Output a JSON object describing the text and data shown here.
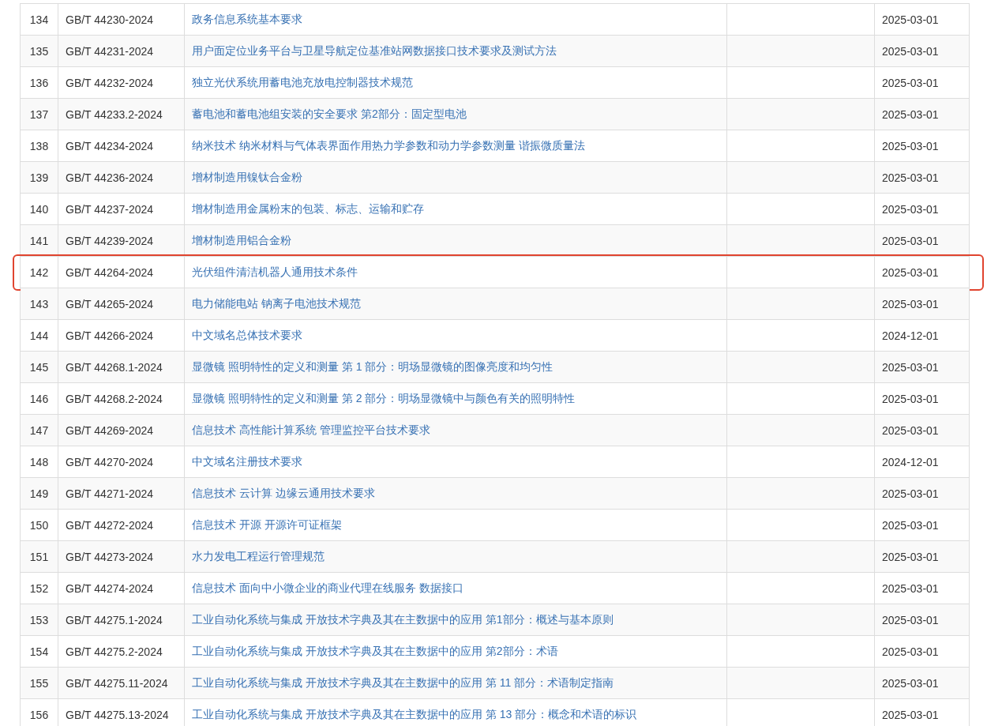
{
  "table": {
    "rows": [
      {
        "number": "134",
        "code": "GB/T 44230-2024",
        "title": "政务信息系统基本要求",
        "date": "2025-03-01",
        "highlighted": false
      },
      {
        "number": "135",
        "code": "GB/T 44231-2024",
        "title": "用户面定位业务平台与卫星导航定位基准站网数据接口技术要求及测试方法",
        "date": "2025-03-01",
        "highlighted": false
      },
      {
        "number": "136",
        "code": "GB/T 44232-2024",
        "title": "独立光伏系统用蓄电池充放电控制器技术规范",
        "date": "2025-03-01",
        "highlighted": false
      },
      {
        "number": "137",
        "code": "GB/T 44233.2-2024",
        "title": "蓄电池和蓄电池组安装的安全要求 第2部分：固定型电池",
        "date": "2025-03-01",
        "highlighted": false
      },
      {
        "number": "138",
        "code": "GB/T 44234-2024",
        "title": "纳米技术 纳米材料与气体表界面作用热力学参数和动力学参数测量 谐振微质量法",
        "date": "2025-03-01",
        "highlighted": false
      },
      {
        "number": "139",
        "code": "GB/T 44236-2024",
        "title": "增材制造用镍钛合金粉",
        "date": "2025-03-01",
        "highlighted": false
      },
      {
        "number": "140",
        "code": "GB/T 44237-2024",
        "title": "增材制造用金属粉末的包装、标志、运输和贮存",
        "date": "2025-03-01",
        "highlighted": false
      },
      {
        "number": "141",
        "code": "GB/T 44239-2024",
        "title": "增材制造用铝合金粉",
        "date": "2025-03-01",
        "highlighted": false
      },
      {
        "number": "142",
        "code": "GB/T 44264-2024",
        "title": "光伏组件清洁机器人通用技术条件",
        "date": "2025-03-01",
        "highlighted": true
      },
      {
        "number": "143",
        "code": "GB/T 44265-2024",
        "title": "电力储能电站 钠离子电池技术规范",
        "date": "2025-03-01",
        "highlighted": false
      },
      {
        "number": "144",
        "code": "GB/T 44266-2024",
        "title": "中文域名总体技术要求",
        "date": "2024-12-01",
        "highlighted": false
      },
      {
        "number": "145",
        "code": "GB/T 44268.1-2024",
        "title": "显微镜 照明特性的定义和测量 第 1 部分：明场显微镜的图像亮度和均匀性",
        "date": "2025-03-01",
        "highlighted": false
      },
      {
        "number": "146",
        "code": "GB/T 44268.2-2024",
        "title": "显微镜 照明特性的定义和测量 第 2 部分：明场显微镜中与颜色有关的照明特性",
        "date": "2025-03-01",
        "highlighted": false
      },
      {
        "number": "147",
        "code": "GB/T 44269-2024",
        "title": "信息技术 高性能计算系统 管理监控平台技术要求",
        "date": "2025-03-01",
        "highlighted": false
      },
      {
        "number": "148",
        "code": "GB/T 44270-2024",
        "title": "中文域名注册技术要求",
        "date": "2024-12-01",
        "highlighted": false
      },
      {
        "number": "149",
        "code": "GB/T 44271-2024",
        "title": "信息技术 云计算 边缘云通用技术要求",
        "date": "2025-03-01",
        "highlighted": false
      },
      {
        "number": "150",
        "code": "GB/T 44272-2024",
        "title": "信息技术 开源 开源许可证框架",
        "date": "2025-03-01",
        "highlighted": false
      },
      {
        "number": "151",
        "code": "GB/T 44273-2024",
        "title": "水力发电工程运行管理规范",
        "date": "2025-03-01",
        "highlighted": false
      },
      {
        "number": "152",
        "code": "GB/T 44274-2024",
        "title": "信息技术 面向中小微企业的商业代理在线服务 数据接口",
        "date": "2025-03-01",
        "highlighted": false
      },
      {
        "number": "153",
        "code": "GB/T 44275.1-2024",
        "title": "工业自动化系统与集成 开放技术字典及其在主数据中的应用 第1部分：概述与基本原则",
        "date": "2025-03-01",
        "highlighted": false
      },
      {
        "number": "154",
        "code": "GB/T 44275.2-2024",
        "title": "工业自动化系统与集成 开放技术字典及其在主数据中的应用 第2部分：术语",
        "date": "2025-03-01",
        "highlighted": false
      },
      {
        "number": "155",
        "code": "GB/T 44275.11-2024",
        "title": "工业自动化系统与集成 开放技术字典及其在主数据中的应用 第 11 部分：术语制定指南",
        "date": "2025-03-01",
        "highlighted": false
      },
      {
        "number": "156",
        "code": "GB/T 44275.13-2024",
        "title": "工业自动化系统与集成 开放技术字典及其在主数据中的应用 第 13 部分：概念和术语的标识",
        "date": "2025-03-01",
        "highlighted": false
      }
    ]
  }
}
